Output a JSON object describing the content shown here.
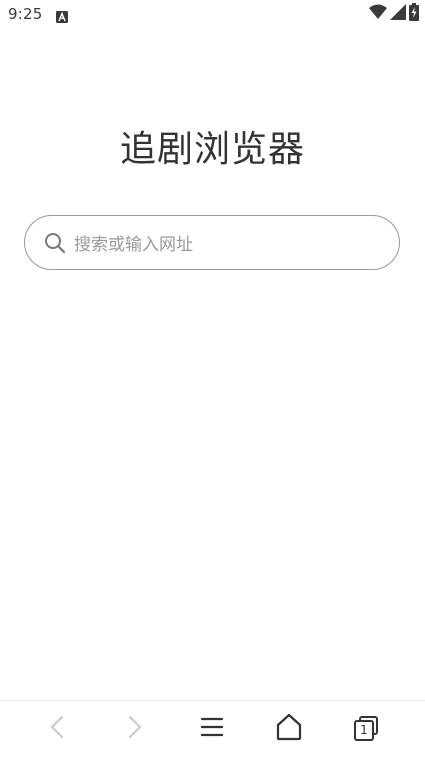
{
  "status_bar": {
    "time": "9:25",
    "notification_icon": "a-badge-icon",
    "right_icons": [
      "wifi-icon",
      "signal-icon",
      "battery-charging-icon"
    ]
  },
  "main": {
    "title": "追剧浏览器",
    "search": {
      "placeholder": "搜索或输入网址",
      "icon": "search-icon"
    }
  },
  "bottom_nav": {
    "items": [
      {
        "icon": "back-arrow-icon",
        "enabled": false
      },
      {
        "icon": "forward-arrow-icon",
        "enabled": false
      },
      {
        "icon": "menu-icon",
        "enabled": true
      },
      {
        "icon": "home-icon",
        "enabled": true
      },
      {
        "icon": "tabs-icon",
        "enabled": true
      }
    ],
    "tab_count": "1"
  },
  "colors": {
    "text_primary": "#333333",
    "placeholder": "#9a9a9a",
    "border": "#9a9a9a",
    "disabled": "#c8c8c8",
    "background": "#ffffff"
  }
}
